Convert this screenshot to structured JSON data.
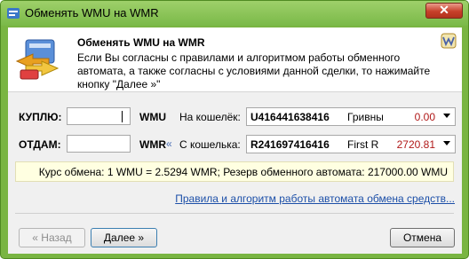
{
  "window": {
    "title": "Обменять WMU на  WMR"
  },
  "header": {
    "title": "Обменять WMU на  WMR",
    "description": "Если Вы согласны с правилами и алгоритмом работы обменного автомата, а также согласны с условиями данной сделки, то нажимайте кнопку \"Далее »\""
  },
  "buy": {
    "label": "КУПЛЮ:",
    "amount": "",
    "currency": "WMU",
    "purse_label": "На кошелёк:",
    "purse_id": "U416441638416",
    "purse_name": "Гривны",
    "balance": "0.00"
  },
  "give": {
    "label": "ОТДАМ:",
    "amount": "",
    "currency": "WMR",
    "arrow": "«",
    "purse_label": "С кошелька:",
    "purse_id": "R241697416416",
    "purse_name": "First R",
    "balance": "2720.81"
  },
  "rate_text": "Курс обмена: 1 WMU = 2.5294 WMR; Резерв обменного автомата: 217000.00 WMU",
  "rules_link": "Правила и алгоритм работы автомата обмена средств...",
  "buttons": {
    "back": "« Назад",
    "next": "Далее »",
    "cancel": "Отмена"
  },
  "colors": {
    "frame": "#79b542",
    "balance": "#b01818",
    "link": "#1c4fa8",
    "info_bg": "#ffffe1"
  },
  "icons": [
    "app-icon",
    "exchange-icon",
    "webmoney-logo-icon",
    "close-icon",
    "dropdown-arrow-icon"
  ]
}
